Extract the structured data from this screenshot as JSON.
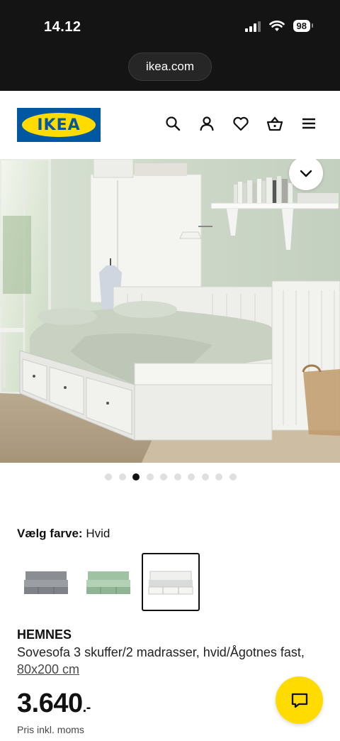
{
  "status_bar": {
    "time": "14.12",
    "battery": "98"
  },
  "browser": {
    "url": "ikea.com"
  },
  "header": {
    "logo_text": "IKEA"
  },
  "gallery": {
    "dot_count": 10,
    "active_index": 2
  },
  "color_picker": {
    "label": "Vælg farve:",
    "selected_value": "Hvid",
    "options": [
      "grå",
      "grøn",
      "hvid"
    ],
    "selected_index": 2
  },
  "product": {
    "name": "HEMNES",
    "description": "Sovesofa 3 skuffer/2 madrasser, hvid/Ågotnes fast,",
    "size": "80x200 cm",
    "price": "3.640",
    "price_suffix": ".-",
    "price_note": "Pris inkl. moms"
  },
  "colors": {
    "ikea_blue": "#0058a3",
    "ikea_yellow": "#ffdb00"
  }
}
